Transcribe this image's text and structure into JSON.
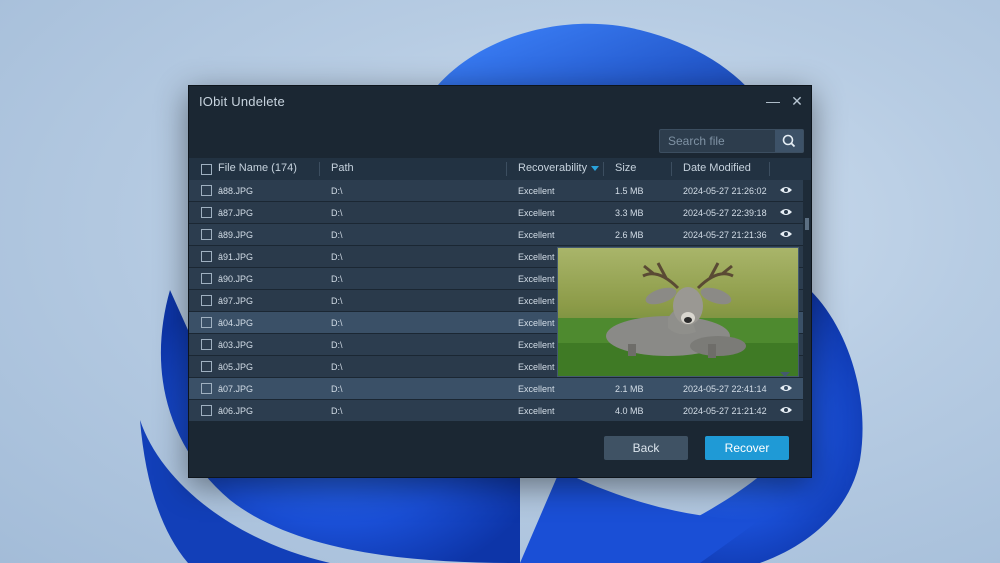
{
  "app": {
    "title": "IObit Undelete"
  },
  "window_controls": {
    "minimize": "—",
    "close": "✕"
  },
  "search": {
    "placeholder": "Search file",
    "value": ""
  },
  "table": {
    "columns": {
      "name": "File Name (174)",
      "path": "Path",
      "recoverability": "Recoverability",
      "size": "Size",
      "date": "Date Modified"
    },
    "rows": [
      {
        "name": "â88.JPG",
        "path": "D:\\",
        "recoverability": "Excellent",
        "size": "1.5 MB",
        "date": "2024-05-27 21:26:02"
      },
      {
        "name": "â87.JPG",
        "path": "D:\\",
        "recoverability": "Excellent",
        "size": "3.3 MB",
        "date": "2024-05-27 22:39:18"
      },
      {
        "name": "â89.JPG",
        "path": "D:\\",
        "recoverability": "Excellent",
        "size": "2.6 MB",
        "date": "2024-05-27 21:21:36"
      },
      {
        "name": "â91.JPG",
        "path": "D:\\",
        "recoverability": "Excellent",
        "size": "",
        "date": ""
      },
      {
        "name": "â90.JPG",
        "path": "D:\\",
        "recoverability": "Excellent",
        "size": "",
        "date": ""
      },
      {
        "name": "â97.JPG",
        "path": "D:\\",
        "recoverability": "Excellent",
        "size": "",
        "date": ""
      },
      {
        "name": "â04.JPG",
        "path": "D:\\",
        "recoverability": "Excellent",
        "size": "",
        "date": ""
      },
      {
        "name": "â03.JPG",
        "path": "D:\\",
        "recoverability": "Excellent",
        "size": "",
        "date": ""
      },
      {
        "name": "â05.JPG",
        "path": "D:\\",
        "recoverability": "Excellent",
        "size": "",
        "date": ""
      },
      {
        "name": "â07.JPG",
        "path": "D:\\",
        "recoverability": "Excellent",
        "size": "2.1 MB",
        "date": "2024-05-27 22:41:14"
      },
      {
        "name": "â06.JPG",
        "path": "D:\\",
        "recoverability": "Excellent",
        "size": "4.0 MB",
        "date": "2024-05-27 21:21:42"
      }
    ]
  },
  "buttons": {
    "back": "Back",
    "recover": "Recover"
  },
  "colors": {
    "accent": "#1f9ad6",
    "window_bg": "#1b2733",
    "sort_indicator": "#29a3dc"
  },
  "icons": [
    "minimize-icon",
    "close-icon",
    "search-icon",
    "sort-desc-icon",
    "eye-icon"
  ]
}
